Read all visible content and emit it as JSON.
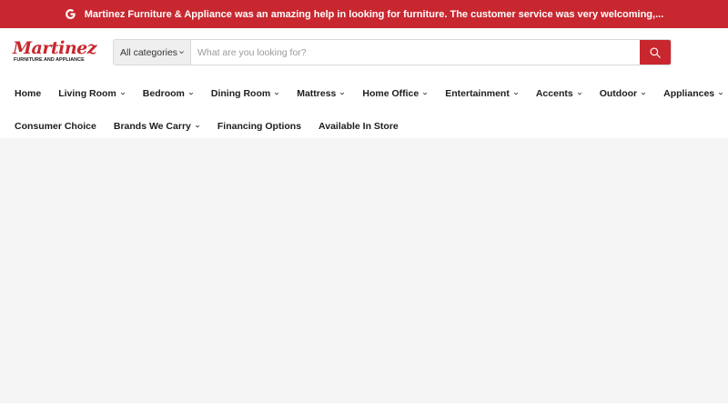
{
  "announcement": {
    "text": "Martinez Furniture & Appliance was an amazing help in looking for furniture. The customer service was very welcoming,...",
    "icon": "google-icon"
  },
  "brand": {
    "logo_main": "Martinez",
    "logo_sub": "FURNITURE AND APPLIANCE",
    "accent_color": "#c8272f"
  },
  "search": {
    "category_label": "All categories",
    "placeholder": "What are you looking for?",
    "value": ""
  },
  "nav": {
    "row1": [
      {
        "label": "Home",
        "dropdown": false
      },
      {
        "label": "Living Room",
        "dropdown": true
      },
      {
        "label": "Bedroom",
        "dropdown": true
      },
      {
        "label": "Dining Room",
        "dropdown": true
      },
      {
        "label": "Mattress",
        "dropdown": true
      },
      {
        "label": "Home Office",
        "dropdown": true
      },
      {
        "label": "Entertainment",
        "dropdown": true
      },
      {
        "label": "Accents",
        "dropdown": true
      },
      {
        "label": "Outdoor",
        "dropdown": true
      },
      {
        "label": "Appliances",
        "dropdown": true
      }
    ],
    "row2": [
      {
        "label": "Consumer Choice",
        "dropdown": false
      },
      {
        "label": "Brands We Carry",
        "dropdown": true
      },
      {
        "label": "Financing Options",
        "dropdown": false
      },
      {
        "label": "Available In Store",
        "dropdown": false
      }
    ]
  }
}
